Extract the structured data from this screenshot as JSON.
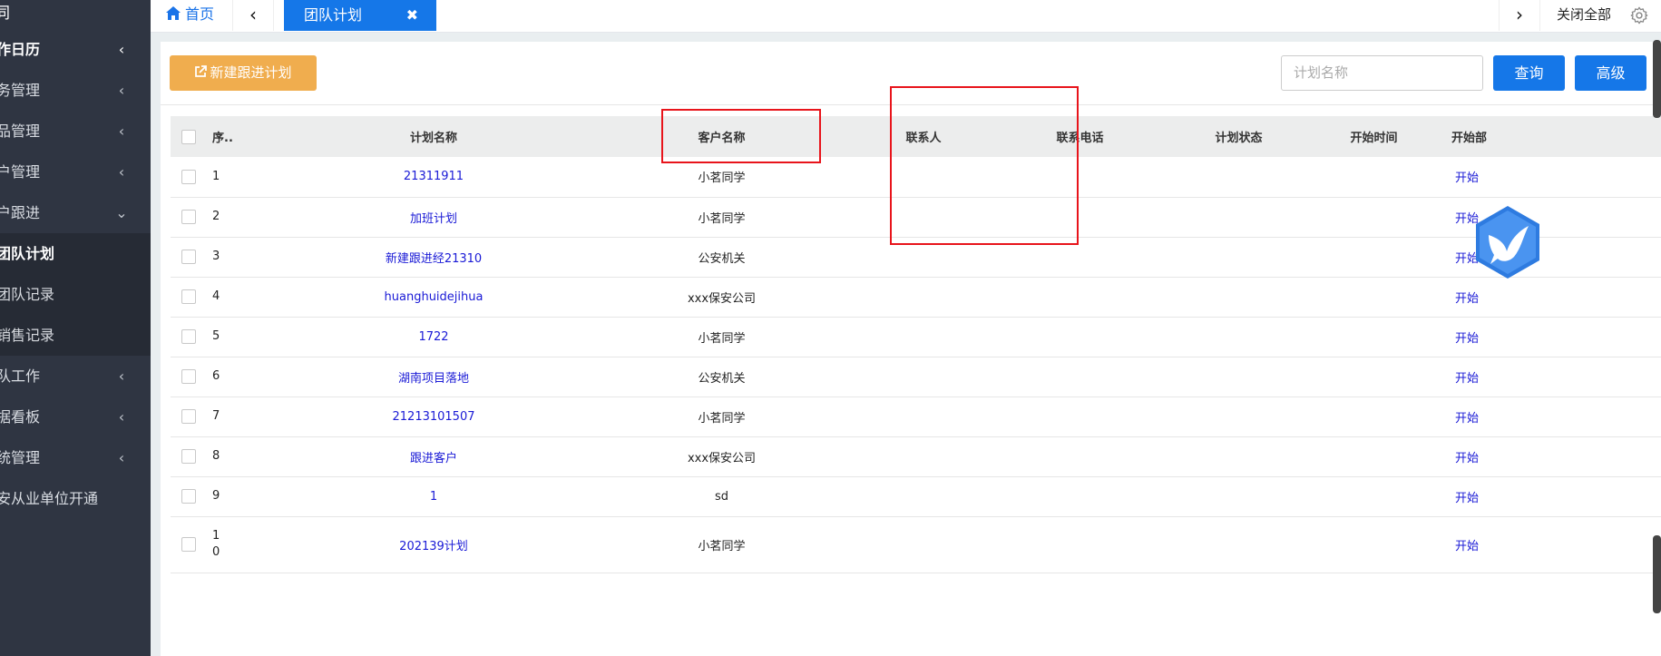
{
  "sidebar": {
    "title": "同",
    "items": [
      {
        "label": "作日历",
        "chevron": "‹",
        "active": true
      },
      {
        "label": "务管理",
        "chevron": "‹"
      },
      {
        "label": "品管理",
        "chevron": "‹"
      },
      {
        "label": "户管理",
        "chevron": "‹"
      },
      {
        "label": "户跟进",
        "chevron": "⌄"
      }
    ],
    "sub_items": [
      {
        "label": "团队计划",
        "current": true
      },
      {
        "label": "团队记录"
      },
      {
        "label": "销售记录"
      }
    ],
    "items_after": [
      {
        "label": "队工作",
        "chevron": "‹"
      },
      {
        "label": "据看板",
        "chevron": "‹"
      },
      {
        "label": "统管理",
        "chevron": "‹"
      },
      {
        "label": "安从业单位开通"
      }
    ]
  },
  "tabs": {
    "home_label": "首页",
    "active_label": "团队计划",
    "close_glyph": "✖",
    "prev_glyph": "‹",
    "next_glyph": "›",
    "close_all_label": "关闭全部",
    "gear_icon": "gear-icon"
  },
  "toolbar": {
    "new_button_label": "新建跟进计划",
    "search_placeholder": "计划名称",
    "query_label": "查询",
    "advanced_label": "高级"
  },
  "table": {
    "headers": [
      "",
      "序..",
      "计划名称",
      "客户名称",
      "联系人",
      "联系电话",
      "计划状态",
      "开始时间",
      "开始部"
    ],
    "rows": [
      {
        "seq": "1",
        "name": "21311911",
        "customer": "小茗同学",
        "contact": "",
        "phone": "",
        "status": "",
        "start_time": "",
        "op": "开始"
      },
      {
        "seq": "2",
        "name": "加班计划",
        "customer": "小茗同学",
        "contact": "",
        "phone": "",
        "status": "",
        "start_time": "",
        "op": "开始"
      },
      {
        "seq": "3",
        "name": "新建跟进经21310",
        "customer": "公安机关",
        "contact": "",
        "phone": "",
        "status": "",
        "start_time": "",
        "op": "开始"
      },
      {
        "seq": "4",
        "name": "huanghuidejihua",
        "customer": "xxx保安公司",
        "contact": "",
        "phone": "",
        "status": "",
        "start_time": "",
        "op": "开始"
      },
      {
        "seq": "5",
        "name": "1722",
        "customer": "小茗同学",
        "contact": "",
        "phone": "",
        "status": "",
        "start_time": "",
        "op": "开始"
      },
      {
        "seq": "6",
        "name": "湖南项目落地",
        "customer": "公安机关",
        "contact": "",
        "phone": "",
        "status": "",
        "start_time": "",
        "op": "开始"
      },
      {
        "seq": "7",
        "name": "21213101507",
        "customer": "小茗同学",
        "contact": "",
        "phone": "",
        "status": "",
        "start_time": "",
        "op": "开始"
      },
      {
        "seq": "8",
        "name": "跟进客户",
        "customer": "xxx保安公司",
        "contact": "",
        "phone": "",
        "status": "",
        "start_time": "",
        "op": "开始"
      },
      {
        "seq": "9",
        "name": "1",
        "customer": "sd",
        "contact": "",
        "phone": "",
        "status": "",
        "start_time": "",
        "op": "开始"
      },
      {
        "seq": "10",
        "name": "202139计划",
        "customer": "小茗同学",
        "contact": "",
        "phone": "",
        "status": "",
        "start_time": "",
        "op": "开始"
      }
    ]
  },
  "colors": {
    "sidebar_bg": "#2f3542",
    "primary": "#1577e8",
    "warning": "#f0ad4e",
    "link": "#1a1ad6",
    "annotation": "#e8141b"
  }
}
